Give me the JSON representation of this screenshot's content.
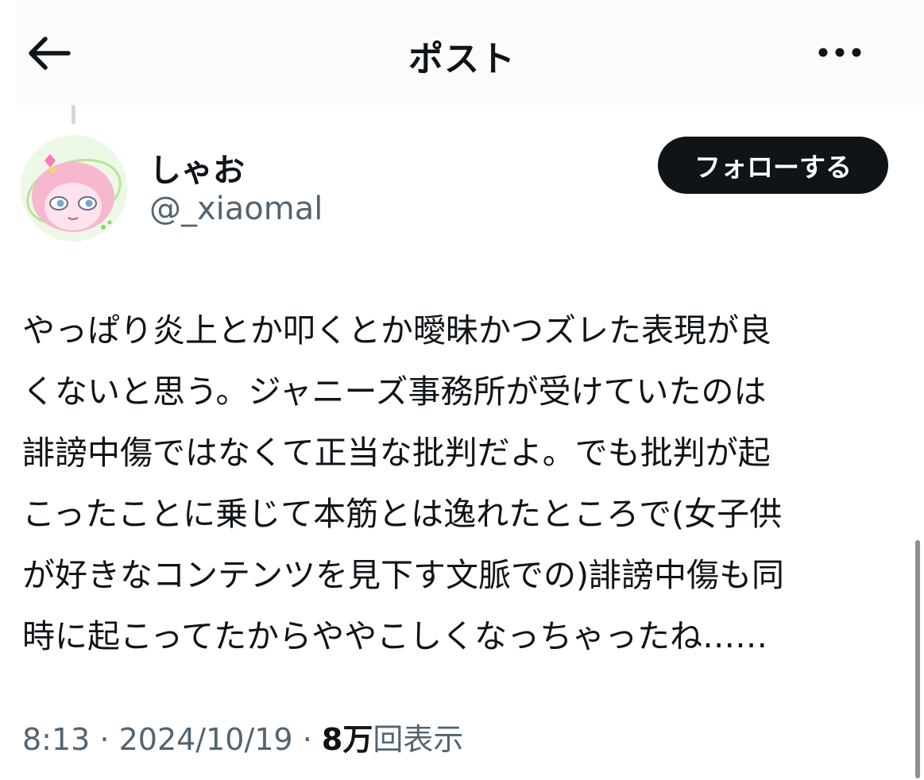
{
  "header": {
    "title": "ポスト",
    "back_icon": "arrow-left-icon",
    "more_icon": "more-horizontal-icon"
  },
  "author": {
    "display_name": "しゃお",
    "handle": "@_xiaomal",
    "avatar_icon": "anime-girl-avatar"
  },
  "follow_button": {
    "label": "フォローする"
  },
  "post": {
    "lines": [
      "やっぱり炎上とか叩くとか曖昧かつズレた表現が良",
      "くないと思う。ジャニーズ事務所が受けていたのは",
      "誹謗中傷ではなくて正当な批判だよ。でも批判が起",
      "こったことに乗じて本筋とは逸れたところで(女子供",
      "が好きなコンテンツを見下す文脈での)誹謗中傷も同",
      "時に起こってたからややこしくなっちゃったね……"
    ]
  },
  "meta": {
    "time": "8:13",
    "separator": " · ",
    "date": "2024/10/19",
    "views_count": "8万",
    "views_label": "回表示"
  },
  "colors": {
    "text": "#0f1419",
    "secondary": "#536471",
    "button_bg": "#0f1419",
    "button_text": "#ffffff"
  }
}
